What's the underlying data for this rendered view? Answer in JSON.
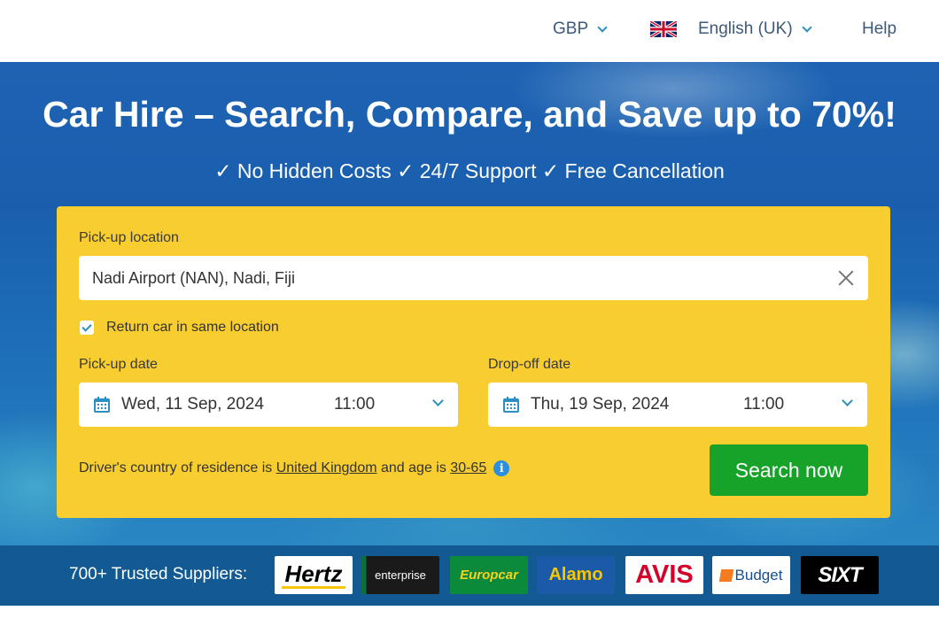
{
  "topbar": {
    "currency": "GBP",
    "language": "English (UK)",
    "help": "Help"
  },
  "hero": {
    "title": "Car Hire – Search, Compare, and Save up to 70%!",
    "subtitle": "✓ No Hidden Costs ✓ 24/7 Support ✓ Free Cancellation"
  },
  "search": {
    "pickup_label": "Pick-up location",
    "pickup_value": "Nadi Airport (NAN), Nadi, Fiji",
    "return_same_label": "Return car in same location",
    "return_same_checked": true,
    "pickup_date_label": "Pick-up date",
    "pickup_date": "Wed, 11 Sep, 2024",
    "pickup_time": "11:00",
    "dropoff_date_label": "Drop-off date",
    "dropoff_date": "Thu, 19 Sep, 2024",
    "dropoff_time": "11:00",
    "driver_prefix": "Driver's country of residence is",
    "driver_country": "United Kingdom",
    "driver_mid": "and age is",
    "driver_age": "30-65",
    "search_button": "Search now"
  },
  "suppliers": {
    "label": "700+ Trusted Suppliers:",
    "logos": [
      "Hertz",
      "enterprise",
      "Europcar",
      "Alamo",
      "AVIS",
      "Budget",
      "SIXT"
    ]
  },
  "colors": {
    "card": "#f8cd2f",
    "search_button": "#17a32a",
    "suppliers_bar": "#135a93",
    "accent": "#2a8fc2"
  }
}
